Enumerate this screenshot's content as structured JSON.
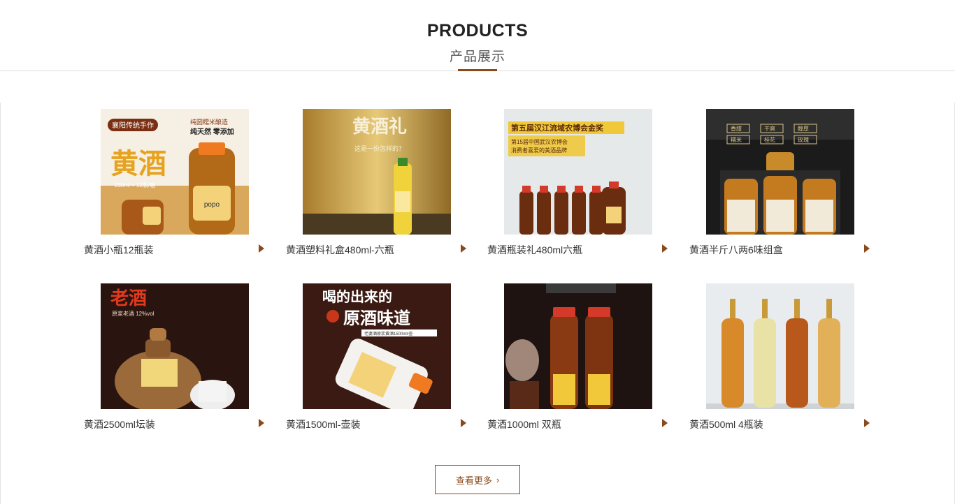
{
  "section": {
    "title_en": "PRODUCTS",
    "title_zh": "产品展示"
  },
  "products": [
    {
      "name": "黄酒小瓶12瓶装",
      "image_text": {
        "tag": "襄阳传统手作",
        "line1": "纯圆糯米酿造",
        "line2": "纯天然 零添加",
        "big": "黄酒",
        "spec": "230ml × 12瓶/箱",
        "label": "popo"
      }
    },
    {
      "name": "黄酒塑料礼盒480ml-六瓶",
      "image_text": {
        "big": "黄酒礼",
        "verse": "这是一份怎样的？"
      }
    },
    {
      "name": "黄酒瓶装礼480ml六瓶",
      "image_text": {
        "award": "第五届汉江流域农博会金奖",
        "sub1": "第15届中国武汉农博会",
        "sub2": "消费者喜爱的美酒品牌"
      }
    },
    {
      "name": "黄酒半斤八两6味组盒",
      "image_text": {
        "labels": [
          "香甜",
          "干爽",
          "醇厚",
          "糯米",
          "桂花",
          "玫瑰"
        ]
      }
    },
    {
      "name": "黄酒2500ml坛装",
      "image_text": {
        "big": "老酒",
        "sub": "原浆老酒 12%vol"
      }
    },
    {
      "name": "黄酒1500ml-壶装",
      "image_text": {
        "big1": "喝的出来的",
        "big2": "原酒味道",
        "sub": "老婆酒原浆黄酒1500ml/壶"
      }
    },
    {
      "name": "黄酒1000ml 双瓶",
      "image_text": {}
    },
    {
      "name": "黄酒500ml 4瓶装",
      "image_text": {}
    }
  ],
  "more_button": {
    "label": "查看更多",
    "chevron": "›"
  },
  "colors": {
    "accent": "#8a4a1c",
    "text": "#333333",
    "heading": "#222222"
  },
  "icons": {
    "caption_arrow": "triangle-right-icon",
    "more_chevron": "chevron-right-icon"
  }
}
